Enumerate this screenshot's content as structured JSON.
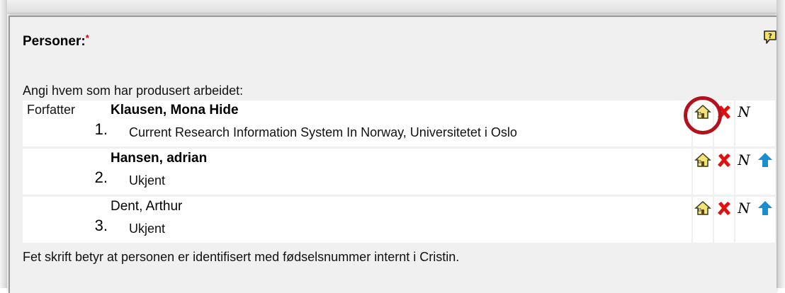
{
  "section": {
    "title": "Personer:",
    "required_mark": "*",
    "help_icon": "speech-bubble-question-icon",
    "instruction": "Angi hvem som har produsert arbeidet:"
  },
  "persons": [
    {
      "role": "Forfatter",
      "name": "Klausen, Mona Hide",
      "bold": true,
      "number": "1.",
      "affiliation": "Current Research Information System In Norway, Universitetet i Oslo",
      "actions": [
        "home-icon",
        "delete-icon",
        "name-icon"
      ]
    },
    {
      "role": "",
      "name": "Hansen, adrian",
      "bold": true,
      "number": "2.",
      "affiliation": "Ukjent",
      "actions": [
        "home-icon",
        "delete-icon",
        "name-icon",
        "move-up-icon"
      ]
    },
    {
      "role": "",
      "name": "Dent, Arthur",
      "bold": false,
      "number": "3.",
      "affiliation": "Ukjent",
      "actions": [
        "home-icon",
        "delete-icon",
        "name-icon",
        "move-up-icon"
      ]
    }
  ],
  "footer_note": "Fet skrift betyr at personen er identifisert med fødselsnummer internt i Cristin.",
  "colors": {
    "panel_bg": "#f0f0f0",
    "required": "#e00000",
    "delete": "#e01010",
    "move_up": "#1a8fd0",
    "home_fill": "#f4e27a",
    "highlight": "#b3111c"
  }
}
